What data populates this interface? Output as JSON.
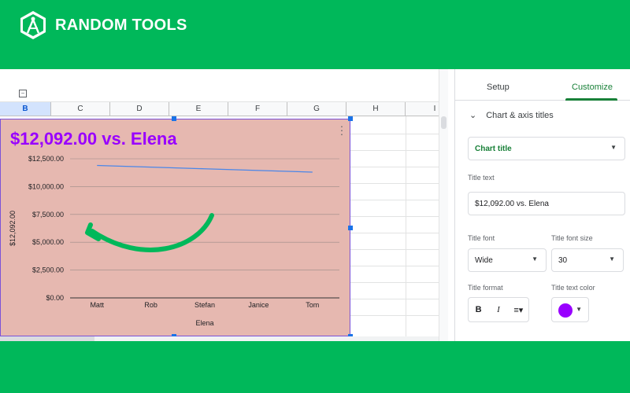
{
  "brand": {
    "name": "RANDOM TOOLS",
    "logo_icon": "compass-icon"
  },
  "sheet": {
    "columns": [
      {
        "label": "B",
        "selected": true
      },
      {
        "label": "C",
        "selected": false
      },
      {
        "label": "D",
        "selected": false
      },
      {
        "label": "E",
        "selected": false
      },
      {
        "label": "F",
        "selected": false
      },
      {
        "label": "G",
        "selected": false
      },
      {
        "label": "H",
        "selected": false
      },
      {
        "label": "I",
        "selected": false
      }
    ]
  },
  "chart_data": {
    "type": "line",
    "title": "$12,092.00 vs. Elena",
    "title_color": "#9900ff",
    "background_color": "#e6b8b0",
    "line_color": "#4a86e8",
    "xlabel": "Elena",
    "ylabel": "$12,092.00",
    "categories": [
      "Matt",
      "Rob",
      "Stefan",
      "Janice",
      "Tom"
    ],
    "series": [
      {
        "values": [
          11900,
          11750,
          11600,
          11450,
          11300
        ]
      }
    ],
    "ylim": [
      0,
      12500
    ],
    "yticks": [
      "$0.00",
      "$2,500.00",
      "$5,000.00",
      "$7,500.00",
      "$10,000.00",
      "$12,500.00"
    ],
    "grid": true,
    "annotation": {
      "type": "arrow",
      "color": "#00b85a",
      "points_to": "line start"
    }
  },
  "panel": {
    "tabs": [
      {
        "label": "Setup",
        "active": false
      },
      {
        "label": "Customize",
        "active": true
      }
    ],
    "section": "Chart & axis titles",
    "title_type_select": "Chart title",
    "title_text_label": "Title text",
    "title_text_value": "$12,092.00 vs. Elena",
    "title_font_label": "Title font",
    "title_font_value": "Wide",
    "title_font_size_label": "Title font size",
    "title_font_size_value": "30",
    "title_format_label": "Title format",
    "bold_label": "B",
    "italic_label": "I",
    "align_icon": "align-left-icon",
    "title_text_color_label": "Title text color",
    "title_text_color": "#9900ff"
  }
}
